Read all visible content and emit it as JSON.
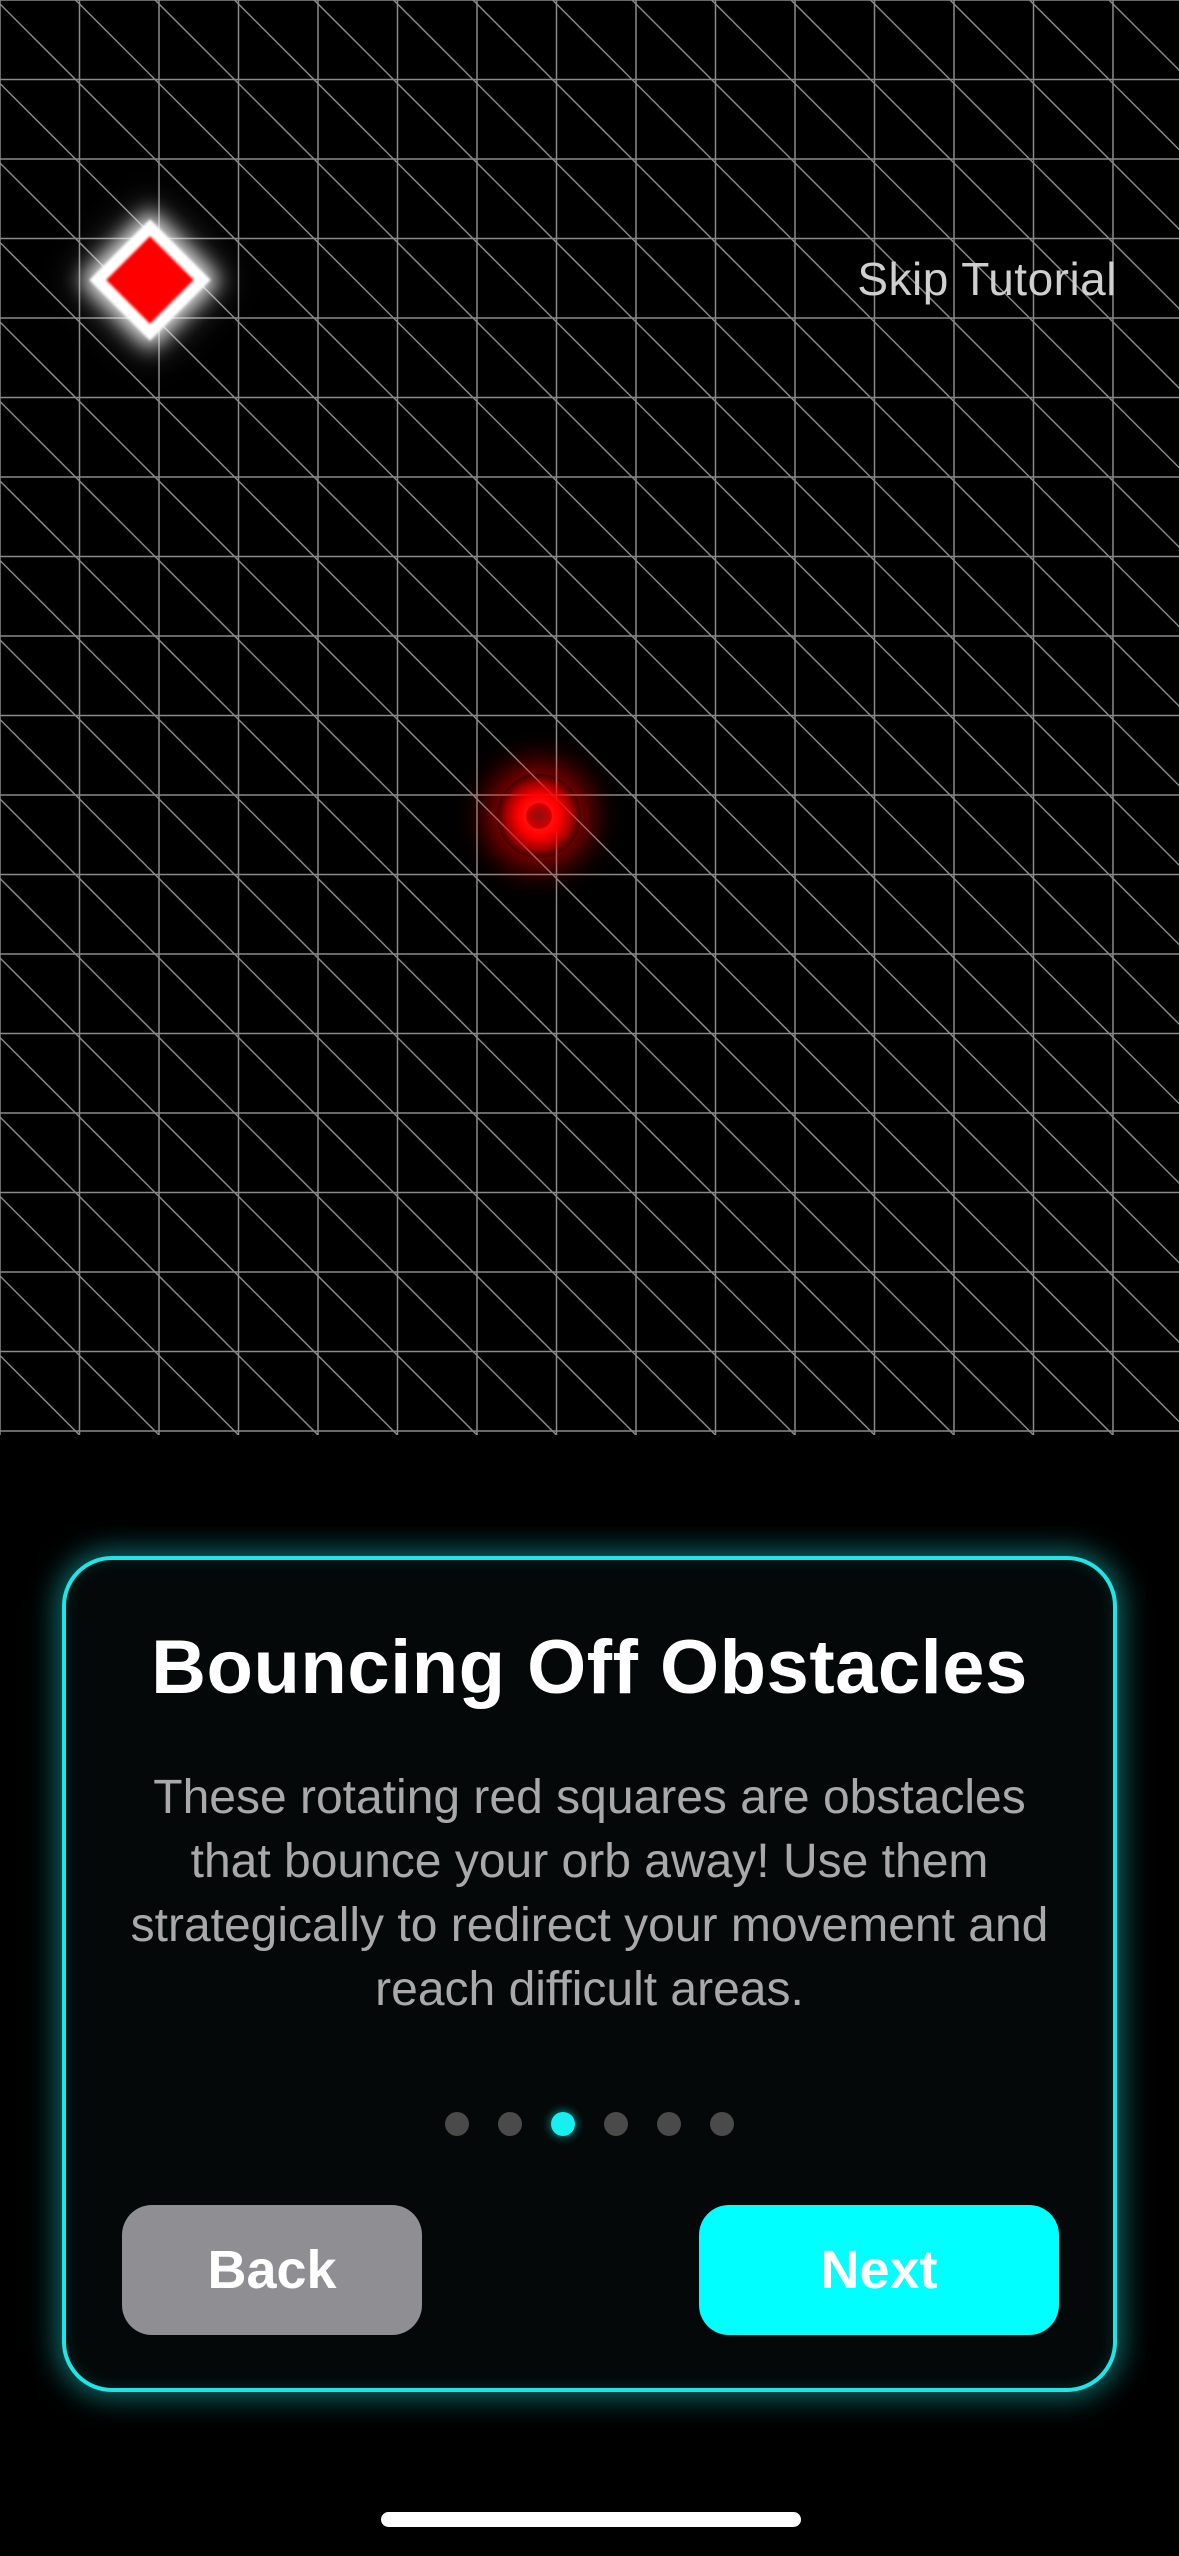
{
  "game": {
    "skip_label": "Skip Tutorial",
    "grid_color": "#8a8a8a",
    "obstacle": {
      "name": "rotating-red-square",
      "fill": "#ff0000",
      "outline": "#ffffff"
    },
    "orb": {
      "color": "#ff0000"
    }
  },
  "tutorial": {
    "title": "Bouncing Off Obstacles",
    "body": "These rotating red squares are obstacles that bounce your orb away! Use them strategically to redirect your movement and reach difficult areas.",
    "total_steps": 6,
    "current_step": 3,
    "back_label": "Back",
    "next_label": "Next"
  },
  "colors": {
    "accent": "#00ffff",
    "card_border": "#1fe6e6",
    "back_button": "#8e8e93",
    "dot_inactive": "#4a4a4a"
  }
}
